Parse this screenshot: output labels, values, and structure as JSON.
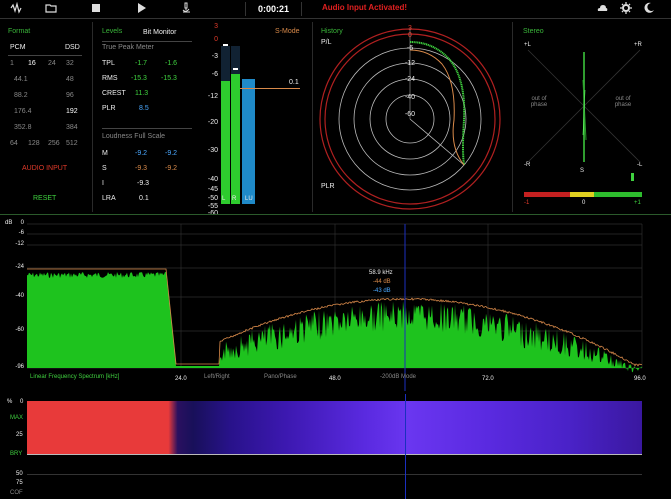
{
  "toolbar": {
    "time": "0:00:21",
    "alert": "Audio Input Activated!"
  },
  "format": {
    "title": "Format",
    "pcm_label": "PCM",
    "dsd_label": "DSD",
    "rows": [
      [
        "1",
        "16",
        "24",
        "32"
      ],
      [
        "44.1",
        "",
        "",
        "48"
      ],
      [
        "88.2",
        "",
        "",
        "96"
      ],
      [
        "176.4",
        "",
        "",
        "192"
      ],
      [
        "352.8",
        "",
        "",
        "384"
      ],
      [
        "64",
        "128",
        "256",
        "512"
      ]
    ],
    "audio_input": "AUDIO INPUT",
    "reset": "RESET"
  },
  "levels": {
    "title": "Levels",
    "bit_monitor": "Bit Monitor",
    "true_peak_header": "True Peak Meter",
    "tpl_label": "TPL",
    "tpl_l": "-1.7",
    "tpl_r": "-1.6",
    "rms_label": "RMS",
    "rms_l": "-15.3",
    "rms_r": "-15.3",
    "crest_label": "CREST",
    "crest_val": "11.3",
    "plr_label": "PLR",
    "plr_val": "8.5",
    "loudness_header": "Loudness Full Scale",
    "m_label": "M",
    "m_l": "-9.2",
    "m_r": "-9.2",
    "s_label": "S",
    "s_l": "-9.3",
    "s_r": "-9.2",
    "i_label": "I",
    "i_val": "-9.3",
    "lra_label": "LRA",
    "lra_val": "0.1"
  },
  "meter": {
    "scale": [
      "3",
      "0",
      "-3",
      "-6",
      "-12",
      "-20",
      "-30",
      "-40",
      "-45",
      "-50",
      "-55",
      "-60"
    ],
    "smode": "S-Mode",
    "marker": "0.1",
    "l": "L",
    "r": "R",
    "lu": "LU",
    "levels": {
      "l": 0.78,
      "r": 0.82,
      "lu": 0.79
    }
  },
  "history": {
    "title": "History",
    "pl": "P/L",
    "plr": "PLR",
    "rings": [
      "3",
      "0",
      "-6",
      "-12",
      "-24",
      "-40",
      "-60"
    ]
  },
  "stereo": {
    "title": "Stereo",
    "pl": "+L",
    "pr": "+R",
    "nr": "-R",
    "nl": "-L",
    "s": "S",
    "oop1": "out of phase",
    "oop2": "out of phase",
    "scale_left": "-1",
    "scale_mid": "0",
    "scale_right": "+1"
  },
  "spectrum": {
    "db_label": "dB",
    "ticks": [
      "0",
      "-6",
      "-12",
      "-24",
      "-40",
      "-60",
      "-96"
    ],
    "tooltip_freq": "58.9 kHz",
    "tooltip_a": "-44 dB",
    "tooltip_b": "-43 dB",
    "title": "Linear Frequency Spectrum [kHz]",
    "x_24": "24.0",
    "x_48": "48.0",
    "x_72": "72.0",
    "x_96": "96.0",
    "left_right": "Left/Right",
    "pano": "Pano/Phase",
    "mode": "-200dB Mode"
  },
  "spectrogram": {
    "pct": "%",
    "zero": "0",
    "max": "MAX",
    "v25": "25",
    "bry": "BRY",
    "v50": "50",
    "v75": "75",
    "cof": "COF"
  },
  "colors": {
    "accent": "#3ab53a",
    "alert": "#e02020",
    "blue": "#4aa8ff"
  }
}
